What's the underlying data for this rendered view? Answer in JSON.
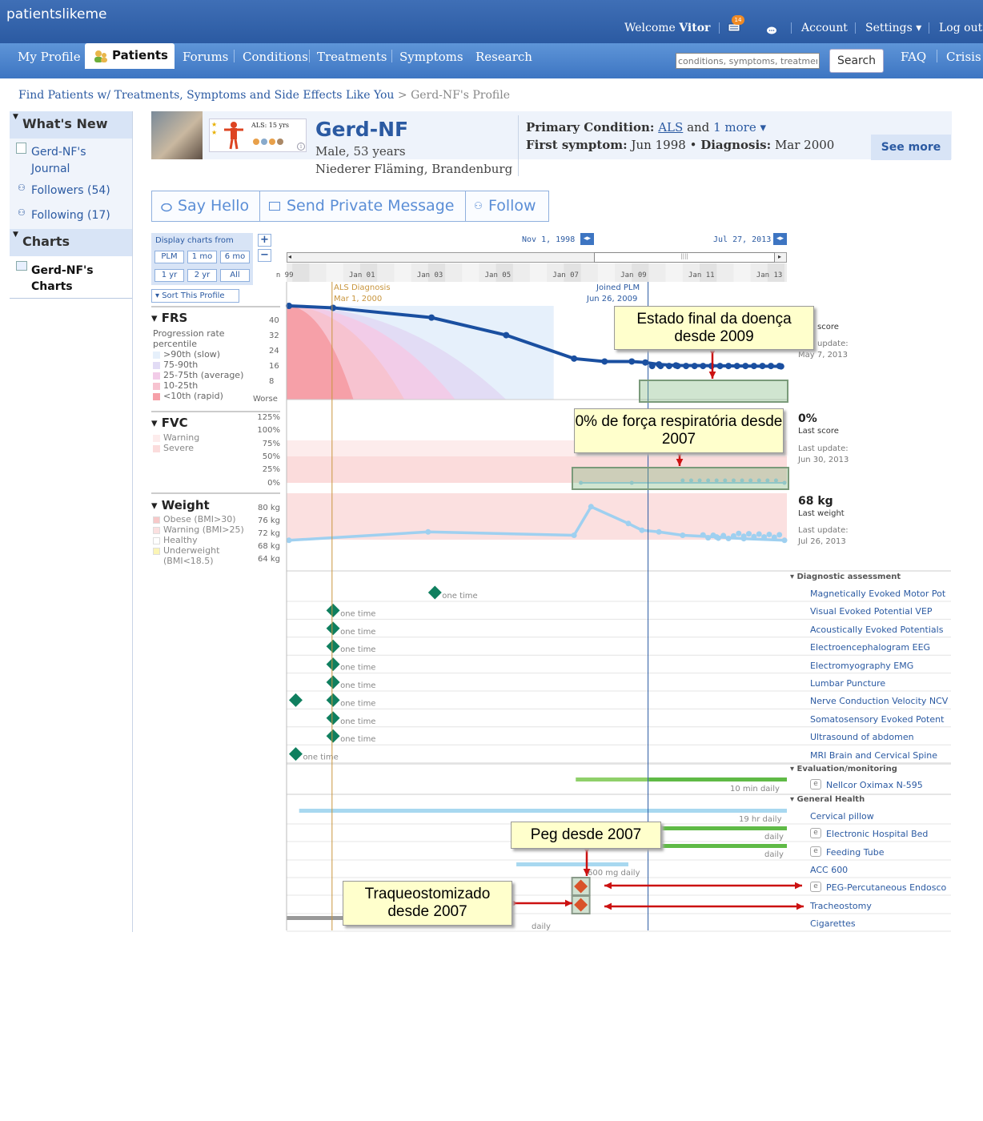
{
  "brand": {
    "logo": "patientslikeme",
    "colors": {
      "nav": "#3d75c2",
      "link": "#2b5aa2",
      "frs_line": "#1a4fa0",
      "light_line": "#9fd0f0",
      "green": "#5fba46",
      "diamond": "#0f7f5f"
    }
  },
  "header": {
    "welcome_prefix": "Welcome",
    "user": "Vitor",
    "mail_count": "14",
    "account": "Account",
    "settings": "Settings ▾",
    "logout": "Log out"
  },
  "nav": {
    "items": [
      "My Profile",
      "Patients",
      "Forums",
      "Conditions",
      "Treatments",
      "Symptoms",
      "Research"
    ],
    "search_placeholder": "conditions, symptoms, treatments...",
    "search_btn": "Search",
    "faq": "FAQ",
    "crisis": "Crisis"
  },
  "breadcrumb": {
    "link": "Find Patients w/ Treatments, Symptoms and Side Effects Like You",
    "sep": ">",
    "current": "Gerd-NF's Profile"
  },
  "sidebar": {
    "whats_new": "What's New",
    "journal": "Gerd-NF's Journal",
    "followers": "Followers (54)",
    "following": "Following (17)",
    "charts": "Charts",
    "charts_item": "Gerd-NF's Charts"
  },
  "profile": {
    "name": "Gerd-NF",
    "info": "Male, 53 years",
    "location": "Niederer Fläming, Brandenburg",
    "als_badge": "ALS: 15 yrs",
    "primary_label": "Primary Condition:",
    "primary_value": "ALS",
    "and": "and",
    "more": "1 more ▾",
    "first_label": "First symptom:",
    "first_value": "Jun 1998",
    "bullet": "•",
    "diag_label": "Diagnosis:",
    "diag_value": "Mar 2000",
    "see_more": "See more"
  },
  "actions": {
    "say_hello": "Say Hello",
    "message": "Send Private Message",
    "follow": "Follow"
  },
  "controls": {
    "display_from": "Display charts from",
    "buttons": [
      "PLM",
      "1 mo",
      "6 mo",
      "1 yr",
      "2 yr",
      "All"
    ],
    "sort": "▾ Sort This Profile",
    "range_start": "Nov 1, 1998",
    "range_end": "Jul 27, 2013"
  },
  "timeline": {
    "years": [
      "n 99",
      "Jan 01",
      "Jan 03",
      "Jan 05",
      "Jan 07",
      "Jan 09",
      "Jan 11",
      "Jan 13"
    ],
    "als_dx": "ALS Diagnosis",
    "als_dx_date": "Mar 1, 2000",
    "joined": "Joined PLM",
    "joined_date": "Jun 26, 2009"
  },
  "frs": {
    "title": "▾ FRS",
    "sub": "Progression rate percentile",
    "legend": [
      ">90th (slow)",
      "75-90th",
      "25-75th (average)",
      "10-25th",
      "<10th (rapid)"
    ],
    "legend_colors": [
      "#e6f0fb",
      "#e2dcf5",
      "#f2cce8",
      "#f7c3d0",
      "#f6a0a8"
    ],
    "ticks": [
      "40",
      "32",
      "24",
      "16",
      "8"
    ],
    "worse": "Worse",
    "score_label": "Last score",
    "update_label": "Last update:",
    "update": "May 7, 2013"
  },
  "fvc": {
    "title": "▾ FVC",
    "legend": [
      "Warning",
      "Severe"
    ],
    "ticks": [
      "125%",
      "100%",
      "75%",
      "50%",
      "25%",
      "0%"
    ],
    "score": "0%",
    "score_label": "Last score",
    "update_label": "Last update:",
    "update": "Jun 30, 2013"
  },
  "weight": {
    "title": "▾ Weight",
    "legend": [
      "Obese (BMI>30)",
      "Warning (BMI>25)",
      "Healthy",
      "Underweight",
      "(BMI<18.5)"
    ],
    "ticks": [
      "80 kg",
      "76 kg",
      "72 kg",
      "68 kg",
      "64 kg"
    ],
    "score": "68 kg",
    "score_label": "Last weight",
    "update_label": "Last update:",
    "update": "Jul 26, 2013"
  },
  "chart_data": [
    {
      "type": "line",
      "title": "FRS",
      "x_unit": "year",
      "ylim": [
        0,
        48
      ],
      "values": [
        [
          1998.9,
          48
        ],
        [
          2000.2,
          47
        ],
        [
          2003.1,
          42
        ],
        [
          2005.3,
          33
        ],
        [
          2007.3,
          21
        ],
        [
          2008.2,
          19.5
        ],
        [
          2009.0,
          19.5
        ],
        [
          2009.4,
          19
        ],
        [
          2009.8,
          18
        ],
        [
          2010.3,
          17.5
        ],
        [
          2013.4,
          17
        ]
      ]
    },
    {
      "type": "line",
      "title": "FVC",
      "x_unit": "year",
      "ylim": [
        0,
        125
      ],
      "values": [
        [
          2007.5,
          0
        ],
        [
          2009.0,
          0
        ],
        [
          2013.5,
          0
        ]
      ]
    },
    {
      "type": "line",
      "title": "Weight",
      "x_unit": "year",
      "ylim": [
        62,
        82
      ],
      "values": [
        [
          1998.9,
          68
        ],
        [
          2003.0,
          70.5
        ],
        [
          2007.3,
          69.5
        ],
        [
          2007.8,
          78
        ],
        [
          2008.9,
          73
        ],
        [
          2009.3,
          71
        ],
        [
          2009.8,
          70.5
        ],
        [
          2010.5,
          69.5
        ],
        [
          2011.5,
          69
        ],
        [
          2012.3,
          68.5
        ],
        [
          2013.5,
          68
        ]
      ]
    }
  ],
  "treatments": {
    "one_time": "one time",
    "cat_diag": "▾ Diagnostic assessment",
    "cat_eval": "▾ Evaluation/monitoring",
    "cat_general": "▾ General Health",
    "diag": [
      "Magnetically Evoked Motor Pot",
      "Visual Evoked Potential VEP",
      "Acoustically Evoked Potentials",
      "Electroencephalogram EEG",
      "Electromyography EMG",
      "Lumbar Puncture",
      "Nerve Conduction Velocity NCV",
      "Somatosensory Evoked Potent",
      "Ultrasound of abdomen",
      "MRI Brain and Cervical Spine"
    ],
    "eval": [
      "Nellcor Oximax N-595"
    ],
    "general": [
      "Cervical pillow",
      "Electronic Hospital Bed",
      "Feeding Tube",
      "ACC 600",
      "PEG-Percutaneous Endosco",
      "Tracheostomy",
      "Cigarettes"
    ],
    "doses": {
      "oximax": "10 min daily",
      "pillow": "19 hr daily",
      "bed": "daily",
      "tube": "daily",
      "acc": "600 mg daily",
      "cig": "daily"
    }
  },
  "callouts": {
    "frs": "Estado final da doença desde 2009",
    "fvc": "0% de força respiratória desde 2007",
    "peg": "Peg desde 2007",
    "trach": "Traqueostomizado desde 2007"
  }
}
